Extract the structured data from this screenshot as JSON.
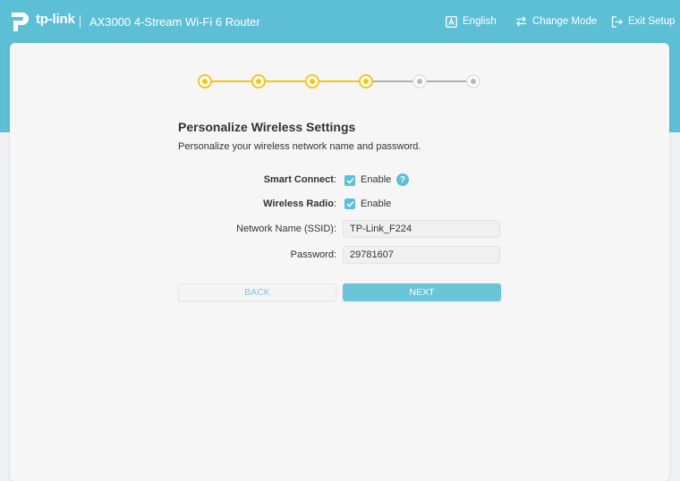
{
  "header": {
    "brand": "tp-link",
    "model": "AX3000 4-Stream Wi-Fi 6 Router",
    "language_label": "English",
    "change_mode_label": "Change Mode",
    "exit_setup_label": "Exit Setup"
  },
  "stepper": {
    "total_steps": 6,
    "completed_steps": 4
  },
  "page": {
    "title": "Personalize Wireless Settings",
    "subtitle": "Personalize your wireless network name and password."
  },
  "form": {
    "smart_connect": {
      "label": "Smart Connect",
      "colon": ":",
      "checkbox_label": "Enable",
      "checked": true
    },
    "wireless_radio": {
      "label": "Wireless Radio",
      "colon": ":",
      "checkbox_label": "Enable",
      "checked": true
    },
    "ssid": {
      "label": "Network Name (SSID):",
      "value": "TP-Link_F224"
    },
    "password": {
      "label": "Password:",
      "value": "29781607"
    }
  },
  "buttons": {
    "back_label": "BACK",
    "next_label": "NEXT"
  },
  "colors": {
    "accent": "#5cbfd5",
    "step_done": "#f5c51a",
    "step_todo": "#b8b8b8"
  }
}
